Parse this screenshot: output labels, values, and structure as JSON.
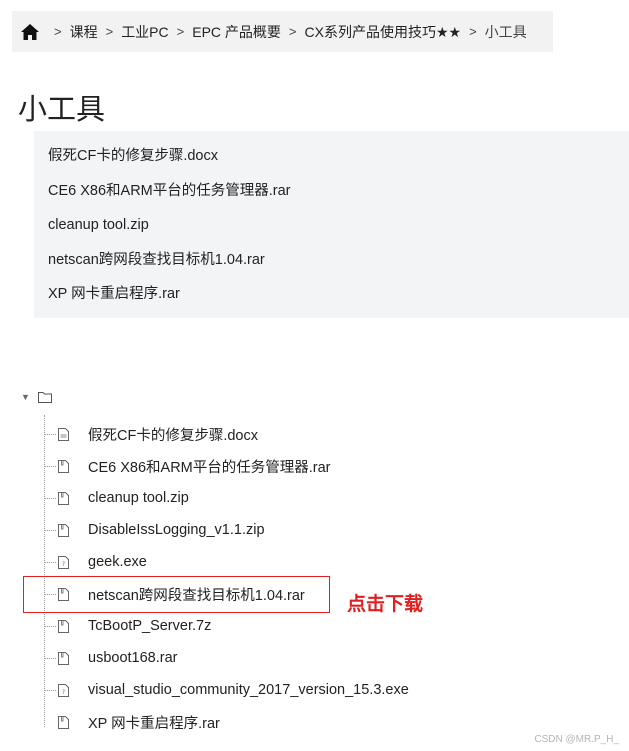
{
  "breadcrumb": {
    "items": [
      "课程",
      "工业PC",
      "EPC 产品概要",
      "CX系列产品使用技巧★★",
      "小工具"
    ],
    "separator": ">"
  },
  "page": {
    "title": "小工具"
  },
  "attachments": [
    "假死CF卡的修复步骤.docx",
    "CE6 X86和ARM平台的任务管理器.rar",
    "cleanup tool.zip",
    "netscan跨网段查找目标机1.04.rar",
    "XP 网卡重启程序.rar"
  ],
  "tree": {
    "root_icon": "folder-icon",
    "expand_icon": "caret-down-icon",
    "items": [
      {
        "name": "假死CF卡的修复步骤.docx",
        "icon": "doc-file-icon"
      },
      {
        "name": "CE6 X86和ARM平台的任务管理器.rar",
        "icon": "file-icon"
      },
      {
        "name": "cleanup tool.zip",
        "icon": "file-icon"
      },
      {
        "name": "DisableIssLogging_v1.1.zip",
        "icon": "file-icon"
      },
      {
        "name": "geek.exe",
        "icon": "exe-file-icon"
      },
      {
        "name": "netscan跨网段查找目标机1.04.rar",
        "icon": "file-icon"
      },
      {
        "name": "TcBootP_Server.7z",
        "icon": "file-icon"
      },
      {
        "name": "usboot168.rar",
        "icon": "file-icon"
      },
      {
        "name": "visual_studio_community_2017_version_15.3.exe",
        "icon": "exe-file-icon"
      },
      {
        "name": "XP 网卡重启程序.rar",
        "icon": "file-icon"
      }
    ]
  },
  "annotation": {
    "text": "点击下载",
    "color": "#e02020"
  },
  "watermark": "CSDN @MR.P_H_"
}
